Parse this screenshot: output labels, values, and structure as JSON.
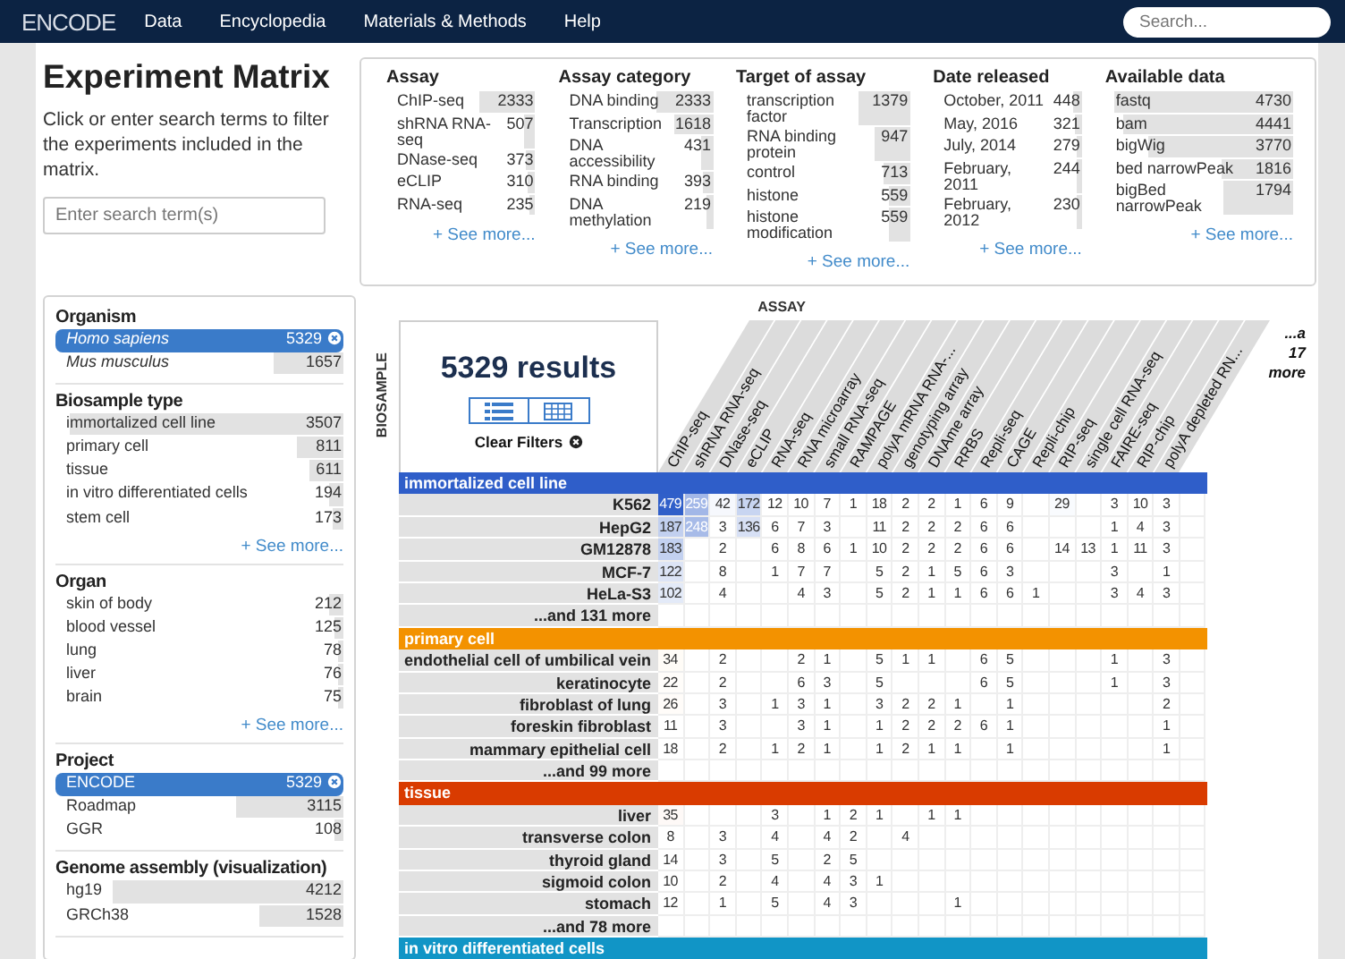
{
  "nav": {
    "logo": "ENCODE",
    "links": [
      "Data",
      "Encyclopedia",
      "Materials & Methods",
      "Help"
    ],
    "search": {
      "placeholder": "Search..."
    }
  },
  "intro": {
    "title": "Experiment Matrix",
    "description": "Click or enter search terms to filter the experiments included in the matrix.",
    "search": {
      "placeholder": "Enter search term(s)"
    }
  },
  "top_facets": [
    {
      "title": "Assay",
      "more": "+ See more...",
      "terms": [
        {
          "label": "ChIP-seq",
          "count": "2333",
          "level": 0.38,
          "selected": false
        },
        {
          "label": "shRNA RNA-seq",
          "count": "507",
          "level": 0.08,
          "selected": false
        },
        {
          "label": "DNase-seq",
          "count": "373",
          "level": 0.06,
          "selected": false
        },
        {
          "label": "eCLIP",
          "count": "310",
          "level": 0.05,
          "selected": false
        },
        {
          "label": "RNA-seq",
          "count": "235",
          "level": 0.04,
          "selected": false
        }
      ]
    },
    {
      "title": "Assay category",
      "more": "+ See more...",
      "terms": [
        {
          "label": "DNA binding",
          "count": "2333",
          "level": 0.36,
          "selected": false
        },
        {
          "label": "Transcription",
          "count": "1618",
          "level": 0.25,
          "selected": false
        },
        {
          "label": "DNA accessibility",
          "count": "431",
          "level": 0.07,
          "selected": false
        },
        {
          "label": "RNA binding",
          "count": "393",
          "level": 0.06,
          "selected": false
        },
        {
          "label": "DNA methylation",
          "count": "219",
          "level": 0.04,
          "selected": false
        }
      ]
    },
    {
      "title": "Target of assay",
      "more": "+ See more...",
      "terms": [
        {
          "label": "transcription factor",
          "count": "1379",
          "level": 0.3,
          "selected": false
        },
        {
          "label": "RNA binding protein",
          "count": "947",
          "level": 0.2,
          "selected": false
        },
        {
          "label": "control",
          "count": "713",
          "level": 0.15,
          "selected": false
        },
        {
          "label": "histone",
          "count": "559",
          "level": 0.12,
          "selected": false
        },
        {
          "label": "histone modification",
          "count": "559",
          "level": 0.12,
          "selected": false
        }
      ]
    },
    {
      "title": "Date released",
      "more": "+ See more...",
      "terms": [
        {
          "label": "October, 2011",
          "count": "448",
          "level": 0.06,
          "selected": false
        },
        {
          "label": "May, 2016",
          "count": "321",
          "level": 0.05,
          "selected": false
        },
        {
          "label": "July, 2014",
          "count": "279",
          "level": 0.04,
          "selected": false
        },
        {
          "label": "February, 2011",
          "count": "244",
          "level": 0.04,
          "selected": false
        },
        {
          "label": "February, 2012",
          "count": "230",
          "level": 0.04,
          "selected": false
        }
      ]
    },
    {
      "title": "Available data",
      "more": "+ See more...",
      "terms": [
        {
          "label": "fastq",
          "count": "4730",
          "level": 0.95,
          "selected": false
        },
        {
          "label": "bam",
          "count": "4441",
          "level": 0.9,
          "selected": false
        },
        {
          "label": "bigWig",
          "count": "3770",
          "level": 0.77,
          "selected": false
        },
        {
          "label": "bed narrowPeak",
          "count": "1816",
          "level": 0.38,
          "selected": false
        },
        {
          "label": "bigBed narrowPeak",
          "count": "1794",
          "level": 0.37,
          "selected": false
        }
      ]
    }
  ],
  "side_facets": [
    {
      "title": "Organism",
      "kind": "organism",
      "terms": [
        {
          "label": "Homo sapiens",
          "count": "5329",
          "selected": true
        },
        {
          "label": "Mus musculus",
          "count": "1657",
          "level": 0.24,
          "selected": false
        }
      ]
    },
    {
      "title": "Biosample type",
      "kind": "plain",
      "more": "+ See more...",
      "terms": [
        {
          "label": "immortalized cell line",
          "count": "3507",
          "level": 0.95,
          "selected": false
        },
        {
          "label": "primary cell",
          "count": "811",
          "level": 0.16,
          "selected": false
        },
        {
          "label": "tissue",
          "count": "611",
          "level": 0.12,
          "selected": false
        },
        {
          "label": "in vitro differentiated cells",
          "count": "194",
          "level": 0.05,
          "selected": false
        },
        {
          "label": "stem cell",
          "count": "173",
          "level": 0.04,
          "selected": false
        }
      ]
    },
    {
      "title": "Organ",
      "kind": "plain",
      "more": "+ See more...",
      "terms": [
        {
          "label": "skin of body",
          "count": "212",
          "level": 0.05,
          "selected": false
        },
        {
          "label": "blood vessel",
          "count": "125",
          "level": 0.03,
          "selected": false
        },
        {
          "label": "lung",
          "count": "78",
          "level": 0.02,
          "selected": false
        },
        {
          "label": "liver",
          "count": "76",
          "level": 0.02,
          "selected": false
        },
        {
          "label": "brain",
          "count": "75",
          "level": 0.02,
          "selected": false
        }
      ]
    },
    {
      "title": "Project",
      "kind": "plain",
      "terms": [
        {
          "label": "ENCODE",
          "count": "5329",
          "selected": true
        },
        {
          "label": "Roadmap",
          "count": "3115",
          "level": 0.37,
          "selected": false
        },
        {
          "label": "GGR",
          "count": "108",
          "level": 0.03,
          "selected": false
        }
      ]
    },
    {
      "title": "Genome assembly (visualization)",
      "kind": "plain",
      "terms": [
        {
          "label": "hg19",
          "count": "4212",
          "level": 0.8,
          "selected": false
        },
        {
          "label": "GRCh38",
          "count": "1528",
          "level": 0.29,
          "selected": false
        }
      ]
    }
  ],
  "matrix": {
    "x_axis": "ASSAY",
    "y_axis": "BIOSAMPLE",
    "results": "5329 results",
    "views": [
      {
        "kind": "list"
      },
      {
        "kind": "table"
      }
    ],
    "clear": "Clear Filters",
    "columns": [
      "ChIP-seq",
      "shRNA RNA-seq",
      "DNase-seq",
      "eCLIP",
      "RNA-seq",
      "RNA microarray",
      "small RNA-seq",
      "RAMPAGE",
      "polyA mRNA RNA-...",
      "genotyping array",
      "DNAme array",
      "RRBS",
      "Repli-seq",
      "CAGE",
      "Repli-chip",
      "RIP-seq",
      "single cell RNA-seq",
      "FAIRE-seq",
      "RIP-chip",
      "polyA depleted RN..."
    ],
    "more_columns": "...a 17 more",
    "groups": [
      {
        "name": "immortalized cell line",
        "color": "#2f5ec9",
        "more": "...and 131 more",
        "rows": [
          {
            "label": "K562",
            "cells": [
              "479",
              "259",
              "42",
              "172",
              "12",
              "10",
              "7",
              "1",
              "18",
              "2",
              "2",
              "1",
              "6",
              "9",
              null,
              "29",
              null,
              "3",
              "10",
              "3"
            ]
          },
          {
            "label": "HepG2",
            "cells": [
              "187",
              "248",
              "3",
              "136",
              "6",
              "7",
              "3",
              null,
              "11",
              "2",
              "2",
              "2",
              "6",
              "6",
              null,
              null,
              null,
              "1",
              "4",
              "3"
            ]
          },
          {
            "label": "GM12878",
            "cells": [
              "183",
              null,
              "2",
              null,
              "6",
              "8",
              "6",
              "1",
              "10",
              "2",
              "2",
              "2",
              "6",
              "6",
              null,
              "14",
              "13",
              "1",
              "11",
              "3"
            ]
          },
          {
            "label": "MCF-7",
            "cells": [
              "122",
              null,
              "8",
              null,
              "1",
              "7",
              "7",
              null,
              "5",
              "2",
              "1",
              "5",
              "6",
              "3",
              null,
              null,
              null,
              "3",
              null,
              "1"
            ]
          },
          {
            "label": "HeLa-S3",
            "cells": [
              "102",
              null,
              "4",
              null,
              null,
              "4",
              "3",
              null,
              "5",
              "2",
              "1",
              "1",
              "6",
              "6",
              "1",
              null,
              null,
              "3",
              "4",
              "3"
            ]
          }
        ]
      },
      {
        "name": "primary cell",
        "color": "#f39200",
        "more": "...and 99 more",
        "rows": [
          {
            "label": "endothelial cell of umbilical vein",
            "cells": [
              "34",
              null,
              "2",
              null,
              null,
              "2",
              "1",
              null,
              "5",
              "1",
              "1",
              null,
              "6",
              "5",
              null,
              null,
              null,
              "1",
              null,
              "3"
            ]
          },
          {
            "label": "keratinocyte",
            "cells": [
              "22",
              null,
              "2",
              null,
              null,
              "6",
              "3",
              null,
              "5",
              null,
              null,
              null,
              "6",
              "5",
              null,
              null,
              null,
              "1",
              null,
              "3"
            ]
          },
          {
            "label": "fibroblast of lung",
            "cells": [
              "26",
              null,
              "3",
              null,
              "1",
              "3",
              "1",
              null,
              "3",
              "2",
              "2",
              "1",
              null,
              "1",
              null,
              null,
              null,
              null,
              null,
              "2"
            ]
          },
          {
            "label": "foreskin fibroblast",
            "cells": [
              "11",
              null,
              "3",
              null,
              null,
              "3",
              "1",
              null,
              "1",
              "2",
              "2",
              "2",
              "6",
              "1",
              null,
              null,
              null,
              null,
              null,
              "1"
            ]
          },
          {
            "label": "mammary epithelial cell",
            "cells": [
              "18",
              null,
              "2",
              null,
              "1",
              "2",
              "1",
              null,
              "1",
              "2",
              "1",
              "1",
              null,
              "1",
              null,
              null,
              null,
              null,
              null,
              "1"
            ]
          }
        ]
      },
      {
        "name": "tissue",
        "color": "#d93b00",
        "more": "...and 78 more",
        "rows": [
          {
            "label": "liver",
            "cells": [
              "35",
              null,
              null,
              null,
              "3",
              null,
              "1",
              "2",
              "1",
              null,
              "1",
              "1",
              null,
              null,
              null,
              null,
              null,
              null,
              null,
              null
            ]
          },
          {
            "label": "transverse colon",
            "cells": [
              "8",
              null,
              "3",
              null,
              "4",
              null,
              "4",
              "2",
              null,
              "4",
              null,
              null,
              null,
              null,
              null,
              null,
              null,
              null,
              null,
              null
            ]
          },
          {
            "label": "thyroid gland",
            "cells": [
              "14",
              null,
              "3",
              null,
              "5",
              null,
              "2",
              "5",
              null,
              null,
              null,
              null,
              null,
              null,
              null,
              null,
              null,
              null,
              null,
              null
            ]
          },
          {
            "label": "sigmoid colon",
            "cells": [
              "10",
              null,
              "2",
              null,
              "4",
              null,
              "4",
              "3",
              "1",
              null,
              null,
              null,
              null,
              null,
              null,
              null,
              null,
              null,
              null,
              null
            ]
          },
          {
            "label": "stomach",
            "cells": [
              "12",
              null,
              "1",
              null,
              "5",
              null,
              "4",
              "3",
              null,
              null,
              null,
              "1",
              null,
              null,
              null,
              null,
              null,
              null,
              null,
              null
            ]
          }
        ]
      },
      {
        "name": "in vitro differentiated cells",
        "color": "#1195c6"
      }
    ]
  }
}
